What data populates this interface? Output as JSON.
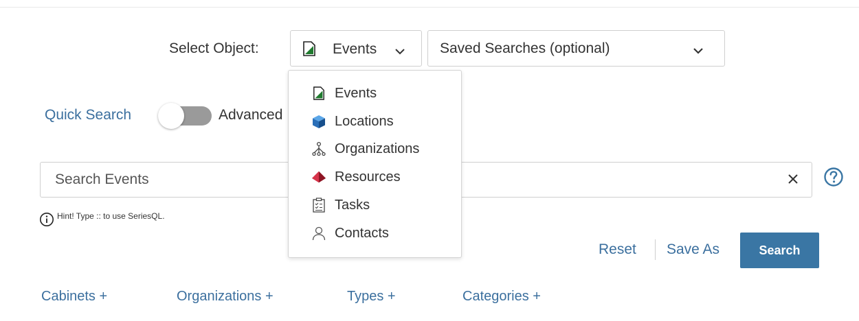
{
  "select_object": {
    "label": "Select Object:",
    "selected": "Events",
    "selected_icon": "events-icon"
  },
  "saved_searches": {
    "selected": "Saved Searches (optional)"
  },
  "mode_toggle": {
    "left_label": "Quick Search",
    "right_label": "Advanced"
  },
  "search": {
    "placeholder": "Search Events",
    "value": "",
    "clear_label": "×"
  },
  "hint": {
    "text": "Hint! Type :: to use SeriesQL."
  },
  "actions": {
    "reset": "Reset",
    "save_as": "Save As",
    "search": "Search"
  },
  "filters": [
    {
      "label": "Cabinets +"
    },
    {
      "label": "Organizations +"
    },
    {
      "label": "Types +"
    },
    {
      "label": "Categories +"
    }
  ],
  "object_menu": {
    "items": [
      {
        "label": "Events",
        "icon": "events-icon"
      },
      {
        "label": "Locations",
        "icon": "locations-icon"
      },
      {
        "label": "Organizations",
        "icon": "organizations-icon"
      },
      {
        "label": "Resources",
        "icon": "resources-icon"
      },
      {
        "label": "Tasks",
        "icon": "tasks-icon"
      },
      {
        "label": "Contacts",
        "icon": "contacts-icon"
      }
    ]
  },
  "colors": {
    "link": "#3b6f9e",
    "button": "#3a76a4",
    "events_green": "#1f7a2e",
    "locations_blue": "#2a6fb8",
    "resources_red": "#c0283a"
  }
}
